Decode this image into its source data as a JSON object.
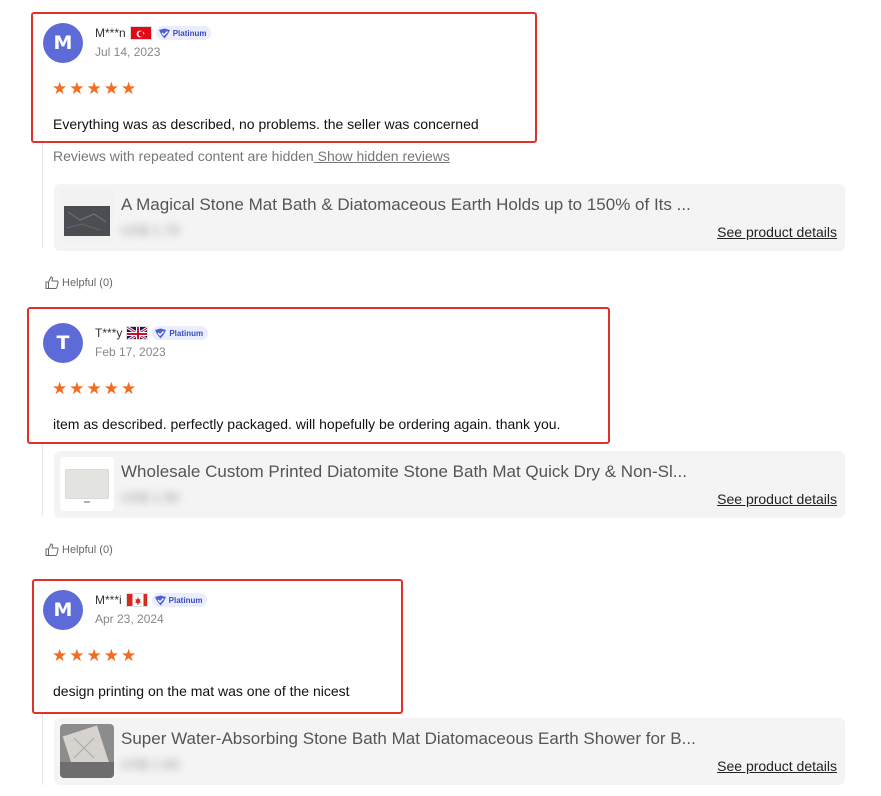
{
  "reviews": [
    {
      "avatar_letter": "M",
      "name": "M***n",
      "flag": "tr-flag-icon",
      "badge": "Platinum",
      "date": "Jul 14, 2023",
      "rating": 5,
      "comment": "Everything was as described, no problems. the seller was concerned",
      "hidden_note": "Reviews with repeated content are hidden",
      "hidden_link": " Show hidden reviews",
      "product_title": "A Magical Stone Mat Bath & Diatomaceous Earth Holds up to 150% of Its ...",
      "price_blurred": "US$ 1.70",
      "details_label": "See product details",
      "helpful": "Helpful (0)"
    },
    {
      "avatar_letter": "T",
      "name": "T***y",
      "flag": "uk-flag-icon",
      "badge": "Platinum",
      "date": "Feb 17, 2023",
      "rating": 5,
      "comment": "item as described. perfectly packaged. will hopefully be ordering again. thank you.",
      "product_title": "Wholesale Custom Printed Diatomite Stone Bath Mat Quick Dry & Non-Sl...",
      "price_blurred": "US$ 1.90",
      "details_label": "See product details",
      "helpful": "Helpful (0)"
    },
    {
      "avatar_letter": "M",
      "name": "M***i",
      "flag": "ca-flag-icon",
      "badge": "Platinum",
      "date": "Apr 23, 2024",
      "rating": 5,
      "comment": "design printing on the mat was one of the nicest",
      "product_title": "Super Water-Absorbing Stone Bath Mat Diatomaceous Earth Shower for B...",
      "price_blurred": "US$ 1.60",
      "details_label": "See product details"
    }
  ],
  "colors": {
    "avatar": "#5d6bd8",
    "star": "#f36c21",
    "highlight": "#e0312b",
    "badge_text": "#3b4cc0"
  }
}
